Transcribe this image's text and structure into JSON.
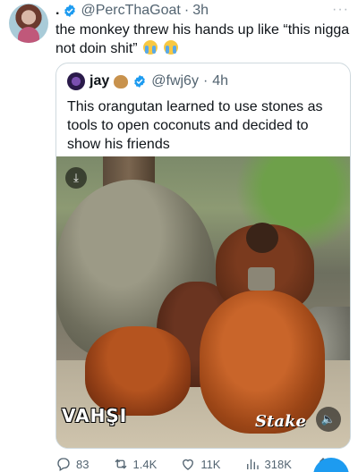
{
  "tweet": {
    "dot": ".",
    "handle": "@PercThaGoat",
    "separator": "·",
    "time": "3h",
    "more_icon": "more-dots-icon",
    "text": "the monkey threw his hands up like “this nigga not doin shit”"
  },
  "quote": {
    "name": "jay",
    "handle": "@fwj6y",
    "separator": "·",
    "time": "4h",
    "text": "This orangutan learned to use stones as tools to open coconuts and decided to show his friends",
    "media": {
      "watermark": "VAHŞI",
      "sponsor": "Stake"
    }
  },
  "actions": {
    "replies": "83",
    "retweets": "1.4K",
    "likes": "11K",
    "views": "318K"
  },
  "colors": {
    "verified": "#1d9bf0",
    "accent": "#1d9bf0",
    "text": "#0f1419",
    "secondary": "#536471",
    "border": "#cfd9de"
  }
}
